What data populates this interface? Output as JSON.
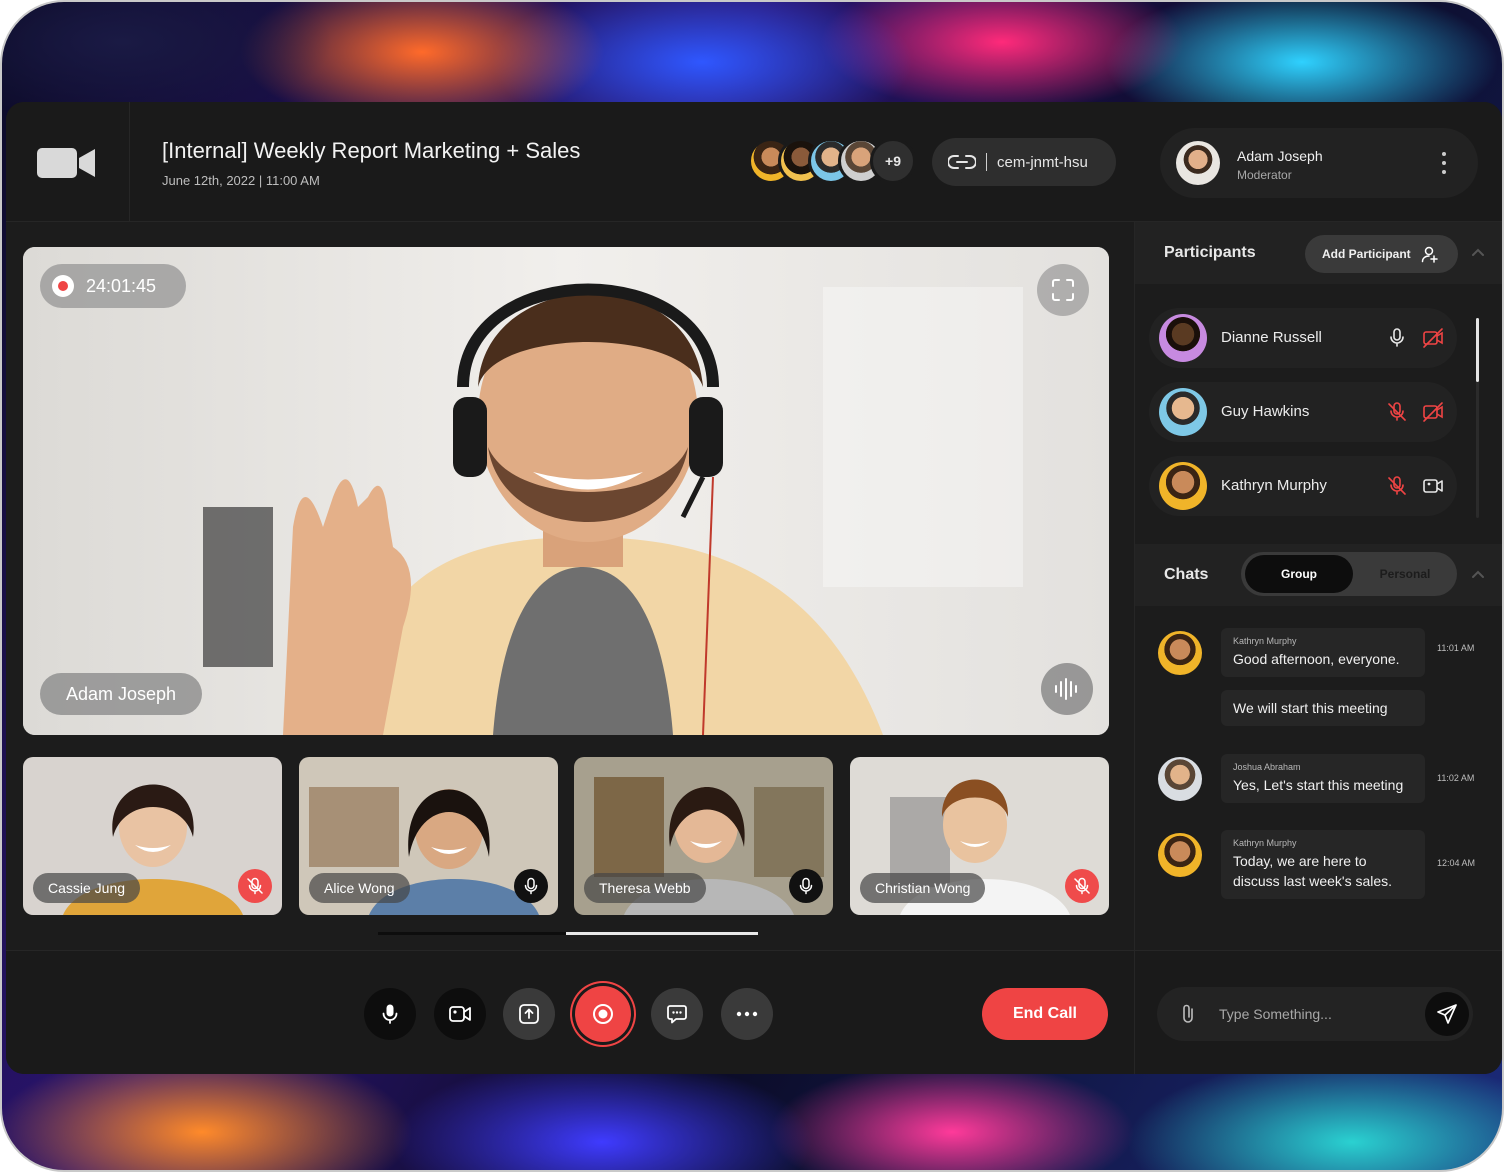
{
  "meeting": {
    "title": "[Internal] Weekly Report Marketing + Sales",
    "datetime": "June 12th, 2022 | 11:00 AM",
    "extra_participants": "+9",
    "meeting_code": "cem-jnmt-hsu"
  },
  "user": {
    "name": "Adam Joseph",
    "role": "Moderator"
  },
  "main_video": {
    "timer": "24:01:45",
    "speaker": "Adam Joseph"
  },
  "thumbnails": [
    {
      "name": "Cassie Jung",
      "mic": "muted"
    },
    {
      "name": "Alice Wong",
      "mic": "on"
    },
    {
      "name": "Theresa Webb",
      "mic": "on"
    },
    {
      "name": "Christian Wong",
      "mic": "muted"
    }
  ],
  "controls": {
    "end_call": "End Call"
  },
  "participants": {
    "label": "Participants",
    "add_label": "Add Participant",
    "list": [
      {
        "name": "Dianne Russell",
        "mic": "on",
        "camera": "off"
      },
      {
        "name": "Guy Hawkins",
        "mic": "muted",
        "camera": "off"
      },
      {
        "name": "Kathryn Murphy",
        "mic": "muted",
        "camera": "on"
      }
    ]
  },
  "chats": {
    "label": "Chats",
    "tabs": [
      "Group",
      "Personal"
    ],
    "active_tab": "Group",
    "messages": [
      {
        "from": "Kathryn Murphy",
        "text": "Good afternoon, everyone.",
        "time": "11:01 AM"
      },
      {
        "from": "",
        "text": "We will start this meeting",
        "time": ""
      },
      {
        "from": "Joshua Abraham",
        "text": "Yes, Let's start this meeting",
        "time": "11:02 AM"
      },
      {
        "from": "Kathryn Murphy",
        "text": "Today, we are here to discuss last week's sales.",
        "time": "12:04 AM"
      }
    ],
    "composer_placeholder": "Type Something..."
  },
  "colors": {
    "accent_red": "#ef4444",
    "panel": "#1c1c1c",
    "surface": "#222222"
  }
}
